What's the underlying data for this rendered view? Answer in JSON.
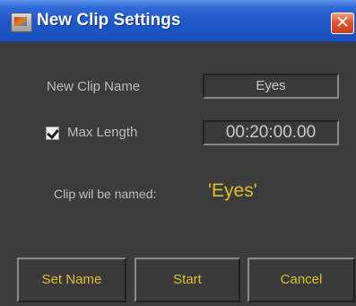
{
  "window": {
    "title": "New Clip Settings",
    "close_glyph": "✕"
  },
  "form": {
    "clip_name_label": "New Clip Name",
    "clip_name_value": "Eyes",
    "max_length_label": "Max Length",
    "max_length_checked": true,
    "max_length_value": "00:20:00.00",
    "named_label": "Clip wil be named:",
    "named_value": "'Eyes'"
  },
  "buttons": {
    "set_name": "Set Name",
    "start": "Start",
    "cancel": "Cancel"
  },
  "colors": {
    "title_bar": "#1f57c9",
    "background": "#3c3c3c",
    "accent": "#e0be28",
    "close": "#e0552e"
  },
  "icons": {
    "app": "java-app-icon",
    "close": "close-icon",
    "check": "checkmark-icon"
  }
}
